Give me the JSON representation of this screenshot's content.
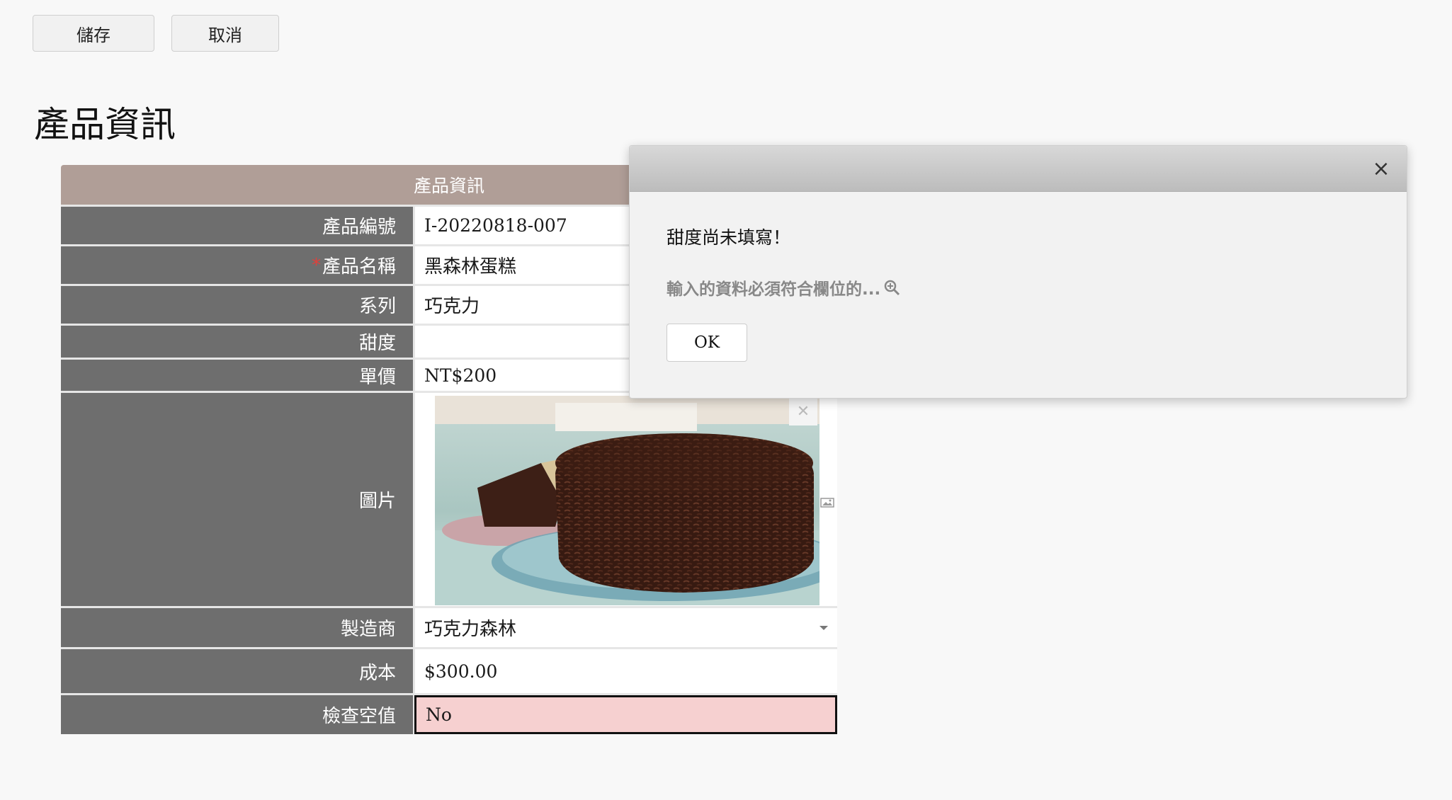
{
  "toolbar": {
    "save_label": "儲存",
    "cancel_label": "取消"
  },
  "page_title": "產品資訊",
  "form": {
    "header": "產品資訊",
    "rows": [
      {
        "label": "產品編號",
        "value": "I-20220818-007"
      },
      {
        "label": "產品名稱",
        "value": "黑森林蛋糕",
        "required_mark": "*"
      },
      {
        "label": "系列",
        "value": "巧克力"
      },
      {
        "label": "甜度",
        "value": ""
      },
      {
        "label": "單價",
        "value": "NT$200"
      },
      {
        "label": "圖片",
        "value": ""
      },
      {
        "label": "製造商",
        "value": "巧克力森林"
      },
      {
        "label": "成本",
        "value": "$300.00"
      },
      {
        "label": "檢查空值",
        "value": "No"
      }
    ]
  },
  "dialog": {
    "message": "甜度尚未填寫！",
    "detail": "輸入的資料必須符合欄位的...",
    "ok_label": "OK",
    "close_glyph": "×"
  },
  "icons": {
    "image_delete": "close-icon",
    "image_upload": "image-icon",
    "dropdown": "chevron-down-icon",
    "detail": "zoom-in-icon"
  },
  "colors": {
    "form_header_bg": "#b09e97",
    "label_bg": "#6e6e6e",
    "error_bg": "#f6d0d0",
    "required": "#e0403a"
  }
}
